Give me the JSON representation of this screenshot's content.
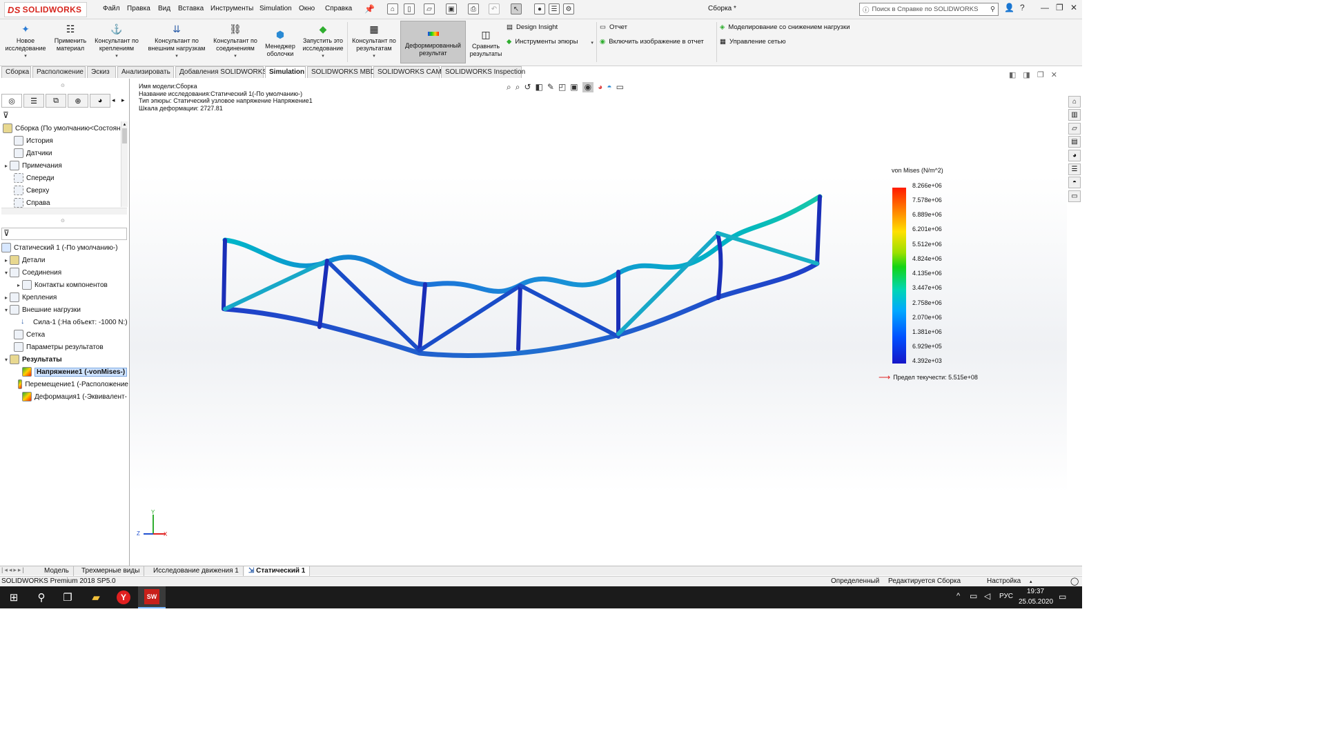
{
  "app": {
    "logo_text": "SOLIDWORKS",
    "logo_mark": "DS",
    "document_title": "Сборка *",
    "help_search_placeholder": "Поиск в Справке по SOLIDWORKS"
  },
  "menu": [
    "Файл",
    "Правка",
    "Вид",
    "Вставка",
    "Инструменты",
    "Simulation",
    "Окно",
    "Справка"
  ],
  "ribbon": {
    "buttons": [
      {
        "label": "Новое исследование",
        "icon": "new-study-icon"
      },
      {
        "label": "Применить материал",
        "icon": "apply-material-icon"
      },
      {
        "label": "Консультант по креплениям",
        "icon": "fixtures-advisor-icon"
      },
      {
        "label": "Консультант по внешним нагрузкам",
        "icon": "external-loads-advisor-icon"
      },
      {
        "label": "Консультант по соединениям",
        "icon": "connections-advisor-icon"
      },
      {
        "label": "Менеджер оболочки",
        "icon": "shell-manager-icon"
      },
      {
        "label": "Запустить это исследование",
        "icon": "run-study-icon"
      },
      {
        "label": "Консультант по результатам",
        "icon": "results-advisor-icon"
      },
      {
        "label": "Деформированный результат",
        "icon": "deformed-result-icon"
      },
      {
        "label": "Сравнить результаты",
        "icon": "compare-results-icon"
      }
    ],
    "small": {
      "design_insight": "Design Insight",
      "plot_tools": "Инструменты эпюры",
      "report": "Отчет",
      "include_image": "Включить изображение в отчет",
      "submodeling": "Моделирование со снижением нагрузки",
      "mesh_control": "Управление сетью"
    }
  },
  "tabs": [
    "Сборка",
    "Расположение",
    "Эскиз",
    "Анализировать",
    "Добавления SOLIDWORKS",
    "Simulation",
    "SOLIDWORKS MBD",
    "SOLIDWORKS CAM",
    "SOLIDWORKS Inspection"
  ],
  "active_tab": "Simulation",
  "feature_tree": {
    "root": "Сборка  (По умолчанию<Состоян",
    "items": [
      "История",
      "Датчики",
      "Примечания",
      "Спереди",
      "Сверху",
      "Справа"
    ]
  },
  "sim_tree": {
    "study": "Статический 1 (-По умолчанию-)",
    "items": [
      {
        "label": "Детали",
        "level": 1
      },
      {
        "label": "Соединения",
        "level": 1
      },
      {
        "label": "Контакты компонентов",
        "level": 2
      },
      {
        "label": "Крепления",
        "level": 1
      },
      {
        "label": "Внешние нагрузки",
        "level": 1
      },
      {
        "label": "Сила-1 (:На объект: -1000 N:)",
        "level": 2
      },
      {
        "label": "Сетка",
        "level": 1
      },
      {
        "label": "Параметры результатов",
        "level": 1
      },
      {
        "label": "Результаты",
        "level": 1
      },
      {
        "label": "Напряжение1 (-vonMises-)",
        "level": 2,
        "selected": true
      },
      {
        "label": "Перемещение1 (-Расположение",
        "level": 2
      },
      {
        "label": "Деформация1 (-Эквивалент-",
        "level": 2
      }
    ]
  },
  "viewport_info": {
    "model_name": "Имя модели:Сборка",
    "study_name": "Название исследования:Статический 1(-По умолчанию-)",
    "plot_type": "Тип эпюры: Статический узловое напряжение Напряжение1",
    "deform_scale": "Шкала деформации: 2727.81"
  },
  "legend": {
    "title": "von Mises (N/m^2)",
    "values": [
      "8.266e+06",
      "7.578e+06",
      "6.889e+06",
      "6.201e+06",
      "5.512e+06",
      "4.824e+06",
      "4.135e+06",
      "3.447e+06",
      "2.758e+06",
      "2.070e+06",
      "1.381e+06",
      "6.929e+05",
      "4.392e+03"
    ],
    "yield": "Предел текучести: 5.515e+08"
  },
  "triad": {
    "x": "X",
    "y": "Y",
    "z": "Z"
  },
  "bottom_tabs": [
    "Модель",
    "Трехмерные виды",
    "Исследование движения 1",
    "Статический 1"
  ],
  "status": {
    "version": "SOLIDWORKS Premium 2018 SP5.0",
    "defined": "Определенный",
    "editing": "Редактируется Сборка",
    "custom": "Настройка"
  },
  "taskbar": {
    "lang": "РУС",
    "time": "19:37",
    "date": "25.05.2020"
  }
}
